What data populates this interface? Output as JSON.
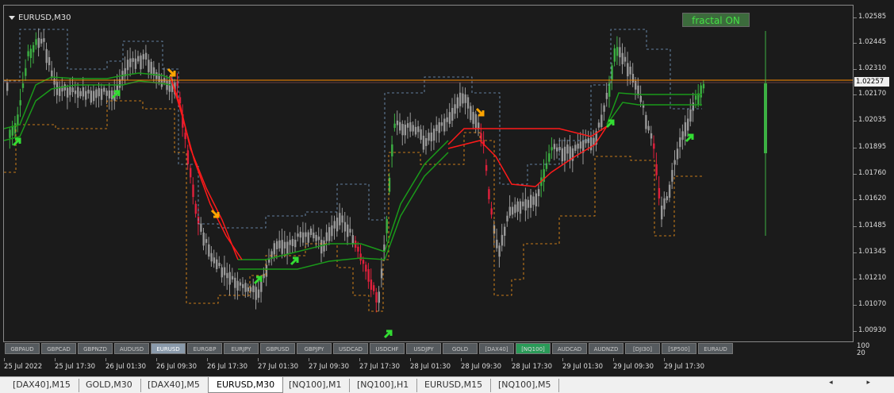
{
  "chart": {
    "title": "EURUSD,M30",
    "indicator_button": "fractal ON",
    "current_price": "1.02257",
    "price_labels": [
      "1.02585",
      "1.02445",
      "1.02310",
      "1.02170",
      "1.02035",
      "1.01895",
      "1.01760",
      "1.01620",
      "1.01485",
      "1.01345",
      "1.01210",
      "1.01070",
      "1.00930"
    ],
    "volume_scale": [
      "100",
      "20"
    ],
    "time_labels": [
      "25 Jul 2022",
      "25 Jul 17:30",
      "26 Jul 01:30",
      "26 Jul 09:30",
      "26 Jul 17:30",
      "27 Jul 01:30",
      "27 Jul 09:30",
      "27 Jul 17:30",
      "28 Jul 01:30",
      "28 Jul 09:30",
      "28 Jul 17:30",
      "29 Jul 01:30",
      "29 Jul 09:30",
      "29 Jul 17:30"
    ],
    "colors": {
      "background": "#1b1b1b",
      "bull_candle": "#3cb043",
      "bear_candle": "#e0203c",
      "neutral_candle": "#999999",
      "channel_green": "#1a9a1a",
      "channel_red": "#ff1a1a",
      "price_line": "#ff8c00",
      "arrow_up": "#33dd33",
      "arrow_down": "#ffa500"
    }
  },
  "symbols": [
    {
      "label": "GBPAUD",
      "state": "normal"
    },
    {
      "label": "GBPCAD",
      "state": "normal"
    },
    {
      "label": "GBPNZD",
      "state": "normal"
    },
    {
      "label": "AUDUSD",
      "state": "normal"
    },
    {
      "label": "EURUSD",
      "state": "active"
    },
    {
      "label": "EURGBP",
      "state": "normal"
    },
    {
      "label": "EURJPY",
      "state": "normal"
    },
    {
      "label": "GBPUSD",
      "state": "normal"
    },
    {
      "label": "GBPJPY",
      "state": "normal"
    },
    {
      "label": "USDCAD",
      "state": "normal"
    },
    {
      "label": "USDCHF",
      "state": "normal"
    },
    {
      "label": "USDJPY",
      "state": "normal"
    },
    {
      "label": "GOLD",
      "state": "normal"
    },
    {
      "label": "[DAX40]",
      "state": "normal"
    },
    {
      "label": "[NQ100]",
      "state": "green"
    },
    {
      "label": "AUDCAD",
      "state": "normal"
    },
    {
      "label": "AUDNZD",
      "state": "normal"
    },
    {
      "label": "[DJI30]",
      "state": "normal"
    },
    {
      "label": "[SP500]",
      "state": "normal"
    },
    {
      "label": "EURAUD",
      "state": "normal"
    }
  ],
  "tabs": [
    {
      "label": "[DAX40],M15",
      "active": false
    },
    {
      "label": "GOLD,M30",
      "active": false
    },
    {
      "label": "[DAX40],M5",
      "active": false
    },
    {
      "label": "EURUSD,M30",
      "active": true
    },
    {
      "label": "[NQ100],M1",
      "active": false
    },
    {
      "label": "[NQ100],H1",
      "active": false
    },
    {
      "label": "EURUSD,M15",
      "active": false
    },
    {
      "label": "[NQ100],M5",
      "active": false
    }
  ],
  "tab_arrows": "◂ ▸"
}
